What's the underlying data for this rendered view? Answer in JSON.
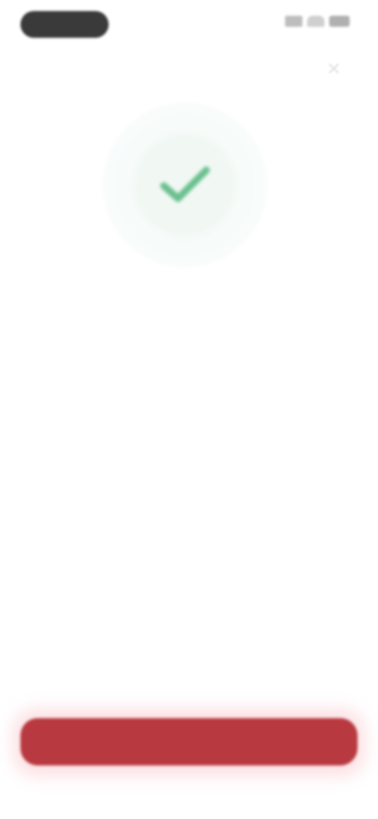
{
  "status_bar": {
    "icons": [
      "cellular-signal-icon",
      "wifi-icon",
      "battery-icon"
    ]
  },
  "header": {
    "close_icon": "close-icon",
    "close_glyph": "✕"
  },
  "hero": {
    "icon": "checkmark-icon",
    "accent_color": "#3fae6e"
  },
  "content": {
    "title": "",
    "subtitle": ""
  },
  "footer": {
    "button_label": "",
    "button_color": "#b8393f"
  }
}
